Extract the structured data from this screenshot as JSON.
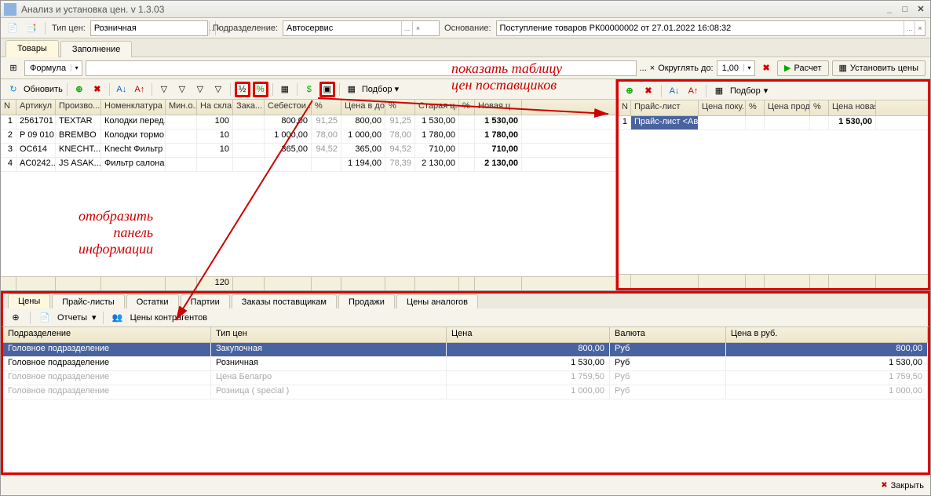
{
  "window": {
    "title": "Анализ и установка цен. v 1.3.03"
  },
  "topbar": {
    "priceType_label": "Тип цен:",
    "priceType_value": "Розничная",
    "division_label": "Подразделение:",
    "division_value": "Автосервис",
    "basis_label": "Основание:",
    "basis_value": "Поступление товаров РК00000002 от 27.01.2022 16:08:32"
  },
  "tabs1": [
    "Товары",
    "Заполнение"
  ],
  "formula_label": "Формула",
  "round_label": "Округлять до:",
  "round_value": "1,00",
  "btn_calc": "Расчет",
  "btn_setprices": "Установить цены",
  "btn_refresh": "Обновить",
  "btn_select": "Подбор",
  "leftGrid": {
    "headers": [
      "N",
      "Артикул",
      "Произво...",
      "Номенклатура",
      "Мин.о...",
      "На скла...",
      "Зака...",
      "Себестои...",
      "%",
      "Цена в до...",
      "%",
      "Старая ц...",
      "%",
      "Новая ц"
    ],
    "rows": [
      {
        "n": "1",
        "art": "2561701",
        "mfr": "TEXTAR",
        "nom": "Колодки перед...",
        "min": "",
        "stock": "100",
        "ord": "",
        "cost": "800,00",
        "p1": "91,25",
        "price_doc": "800,00",
        "p2": "91,25",
        "old": "1 530,00",
        "p3": "",
        "new": "1 530,00"
      },
      {
        "n": "2",
        "art": "P 09 010",
        "mfr": "BREMBO",
        "nom": "Колодки тормо...",
        "min": "",
        "stock": "10",
        "ord": "",
        "cost": "1 000,00",
        "p1": "78,00",
        "price_doc": "1 000,00",
        "p2": "78,00",
        "old": "1 780,00",
        "p3": "",
        "new": "1 780,00"
      },
      {
        "n": "3",
        "art": "OC614",
        "mfr": "KNECHT...",
        "nom": "Knecht  Фильтр ...",
        "min": "",
        "stock": "10",
        "ord": "",
        "cost": "365,00",
        "p1": "94,52",
        "price_doc": "365,00",
        "p2": "94,52",
        "old": "710,00",
        "p3": "",
        "new": "710,00"
      },
      {
        "n": "4",
        "art": "AC0242...",
        "mfr": "JS ASAK...",
        "nom": "Фильтр салона...",
        "min": "",
        "stock": "",
        "ord": "",
        "cost": "",
        "p1": "",
        "price_doc": "1 194,00",
        "p2": "78,39",
        "old": "2 130,00",
        "p3": "",
        "new": "2 130,00"
      }
    ],
    "footer_stock": "120"
  },
  "rightGrid": {
    "headers": [
      "N",
      "Прайс-лист",
      "Цена поку...",
      "%",
      "Цена прод...",
      "%",
      "Цена новая"
    ],
    "rows": [
      {
        "n": "1",
        "pl": "Прайс-лист <Авт...",
        "buy": "",
        "p1": "",
        "sell": "",
        "p2": "",
        "new": "1 530,00"
      }
    ]
  },
  "bottomTabs": [
    "Цены",
    "Прайс-листы",
    "Остатки",
    "Партии",
    "Заказы поставщикам",
    "Продажи",
    "Цены аналогов"
  ],
  "bottomTool": {
    "reports": "Отчеты",
    "contragent_prices": "Цены контрагентов"
  },
  "bottomGrid": {
    "headers": [
      "Подразделение",
      "Тип цен",
      "Цена",
      "Валюта",
      "Цена в руб."
    ],
    "rows": [
      {
        "div": "Головное подразделение",
        "type": "Закупочная",
        "price": "800,00",
        "cur": "Руб",
        "rub": "800,00",
        "sel": true
      },
      {
        "div": "Головное подразделение",
        "type": "Розничная",
        "price": "1 530,00",
        "cur": "Руб",
        "rub": "1 530,00"
      },
      {
        "div": "Головное подразделение",
        "type": "Цена Белагро",
        "price": "1 759,50",
        "cur": "Руб",
        "rub": "1 759,50",
        "gray": true
      },
      {
        "div": "Головное подразделение",
        "type": "Розница ( special )",
        "price": "1 000,00",
        "cur": "Руб",
        "rub": "1 000,00",
        "gray": true
      }
    ]
  },
  "footer_close": "Закрыть",
  "annotations": {
    "showSupplierPrices1": "показать таблицу",
    "showSupplierPrices2": "цен поставщиков",
    "showInfoPanel1": "отобразить",
    "showInfoPanel2": "панель",
    "showInfoPanel3": "информации"
  }
}
